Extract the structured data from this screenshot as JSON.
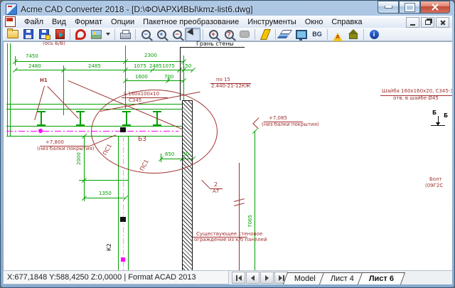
{
  "window": {
    "title": "Acme CAD Converter 2018 - [D:\\ФО\\АРХИВЫ\\kmz-list6.dwg]"
  },
  "menu": {
    "items": [
      "Файл",
      "Вид",
      "Формат",
      "Опции",
      "Пакетное преобразование",
      "Инструменты",
      "Окно",
      "Справка"
    ]
  },
  "toolbar": {
    "bg_label": "BG",
    "glyphs": {
      "zoom_out": "−",
      "zoom_in": "+",
      "zoom_region": "−",
      "zoom_extents": "+",
      "zoom_previous": "?",
      "info": "i",
      "warn": "A"
    }
  },
  "drawing": {
    "colors": {
      "dimension_green": "#00a000",
      "annotation_red": "#a03030",
      "centerline_magenta": "#ff00ff",
      "column_pink": "#ff9ccc"
    },
    "dims": {
      "d7450": "7450",
      "d2300": "2300",
      "d2480": "2480",
      "d2485a": "2485",
      "d1075a": "1075",
      "d2485b": "2485",
      "d1075b": "1075",
      "d150": "150",
      "d1600": "1600",
      "d700": "700",
      "d2000": "2000",
      "d1350": "1350",
      "d650": "650",
      "d50": "50",
      "d7065": "7065"
    },
    "marks": {
      "axis_note": "(ось Б/В)",
      "wall_face": "Грань стены",
      "n1": "Н1",
      "b3": "Б3",
      "ps1": "ПС1",
      "k2": "К2",
      "detail_num": "2",
      "detail_sheet": "А7",
      "section_b": "Б"
    },
    "notes": {
      "angle_size": "L 160х100х10",
      "angle_steel": "С345",
      "po15": "по 15",
      "po15_ref": "2.440-21-12КЖ",
      "level_right": "+7,085",
      "level_right_note": "(низ балки покрытия)",
      "level_left": "+7,800",
      "level_left_note": "(низ балки покрытия)",
      "wall_note_1": "Существующее стеновое",
      "wall_note_2": "ограждение из к/б панелей",
      "washer_1": "Шайба 160х160х20, С345-3",
      "washer_2": "отв. в шайбе Ø45",
      "bolt_1": "Болт",
      "bolt_2": "(09Г2С"
    }
  },
  "statusbar": {
    "text": "X:677,1848 Y:588,4250 Z:0,0000 | Format ACAD 2013"
  },
  "tabs": {
    "items": [
      "Model",
      "Лист 4",
      "Лист 6"
    ],
    "active_index": 2
  }
}
